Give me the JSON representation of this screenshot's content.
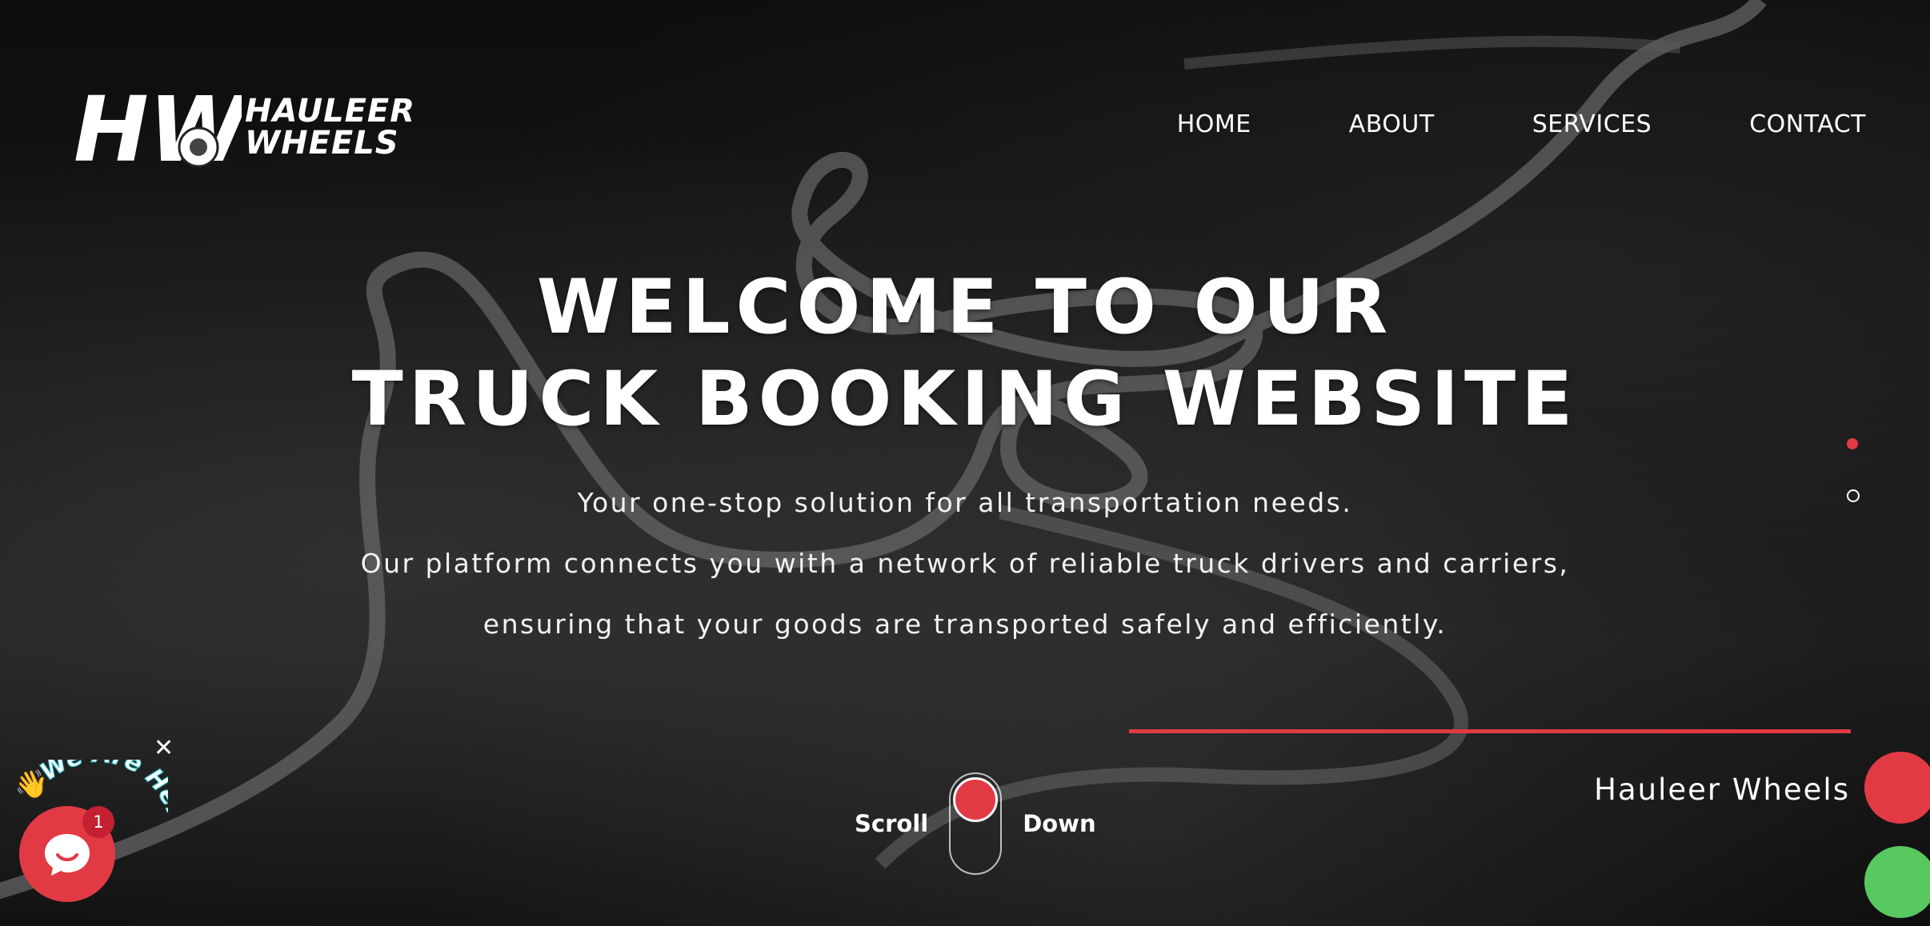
{
  "brand": {
    "line1": "HAULEER",
    "line2": "WHEELS",
    "mark": "HW"
  },
  "nav": {
    "items": [
      "HOME",
      "ABOUT",
      "SERVICES",
      "CONTACT"
    ]
  },
  "hero": {
    "headline_line1": "WELCOME TO OUR",
    "headline_line2": "TRUCK BOOKING WEBSITE",
    "desc_line1": "Your one-stop solution for all transportation needs.",
    "desc_line2": "Our platform connects you with a network of reliable truck drivers and carriers,",
    "desc_line3": "ensuring that your goods are transported safely and efficiently."
  },
  "slider": {
    "dot_count": 2,
    "active_index": 0
  },
  "caption": {
    "text": "Hauleer Wheels"
  },
  "scroll": {
    "left": "Scroll",
    "right": "Down"
  },
  "chat": {
    "arc_text": "We Are Here!",
    "badge_count": "1",
    "close_symbol": "✕",
    "wave_emoji": "👋"
  },
  "colors": {
    "accent_red": "#e23a45",
    "accent_green": "#58c860",
    "text": "#ffffff",
    "background": "#0a0a0a"
  }
}
